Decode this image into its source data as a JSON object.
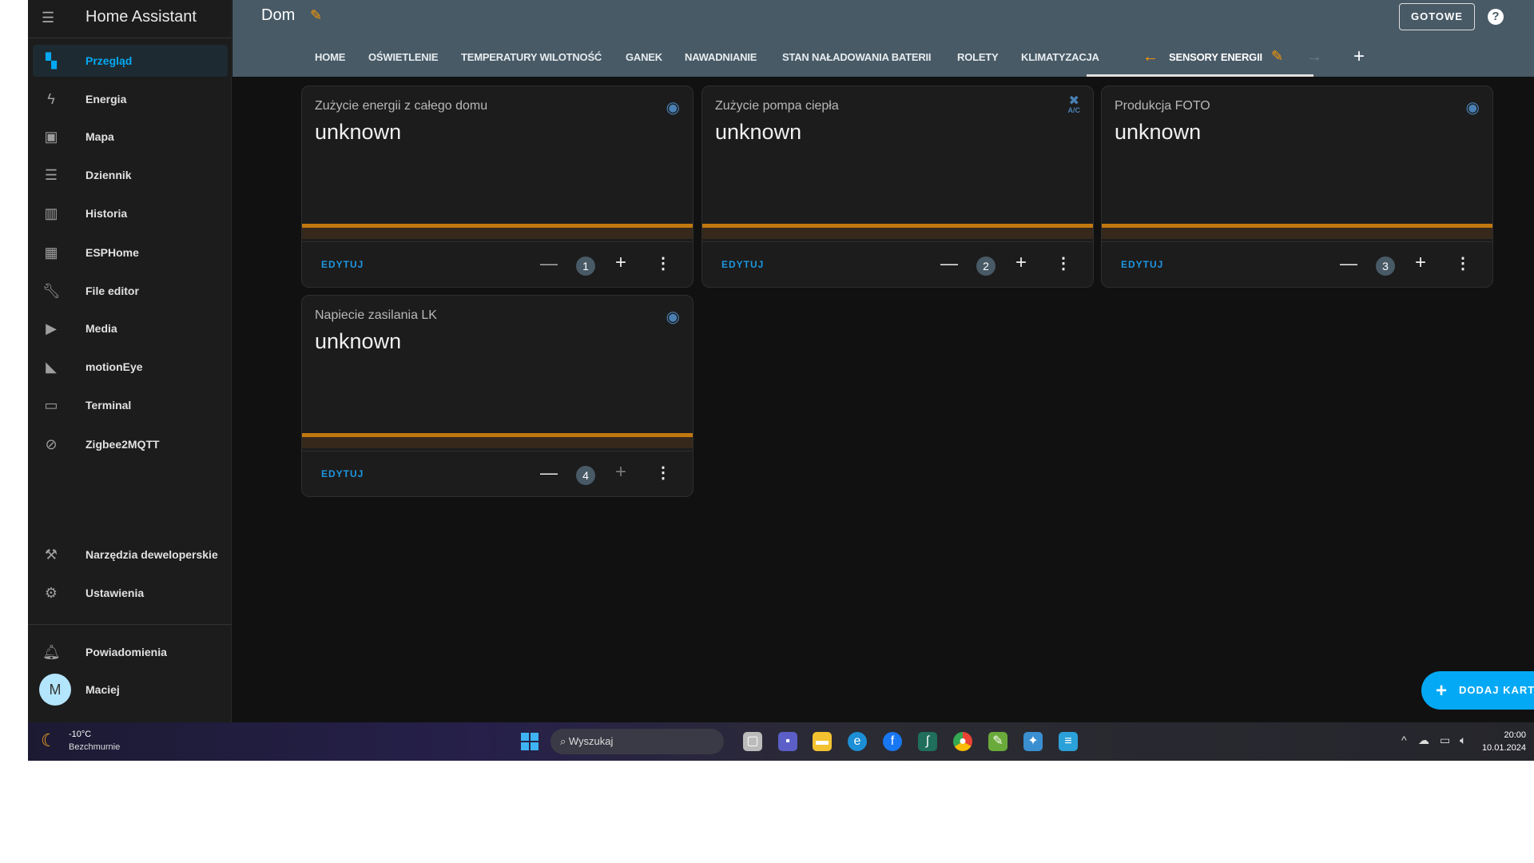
{
  "sidebar": {
    "title": "Home Assistant",
    "items": [
      {
        "label": "Przegląd",
        "icon": "dashboard-icon",
        "active": true
      },
      {
        "label": "Energia",
        "icon": "lightning-icon"
      },
      {
        "label": "Mapa",
        "icon": "map-person-icon"
      },
      {
        "label": "Dziennik",
        "icon": "list-icon"
      },
      {
        "label": "Historia",
        "icon": "chart-box-icon"
      },
      {
        "label": "ESPHome",
        "icon": "chip-icon"
      },
      {
        "label": "File editor",
        "icon": "wrench-icon"
      },
      {
        "label": "Media",
        "icon": "play-box-icon"
      },
      {
        "label": "motionEye",
        "icon": "cctv-icon"
      },
      {
        "label": "Terminal",
        "icon": "console-icon"
      },
      {
        "label": "Zigbee2MQTT",
        "icon": "zigbee-icon"
      }
    ],
    "bottom": [
      {
        "label": "Narzędzia deweloperskie",
        "icon": "hammer-icon"
      },
      {
        "label": "Ustawienia",
        "icon": "gear-icon"
      },
      {
        "label": "Powiadomienia",
        "icon": "bell-icon"
      }
    ],
    "user": {
      "initial": "M",
      "name": "Maciej"
    }
  },
  "header": {
    "title": "Dom",
    "done_label": "GOTOWE",
    "tabs": [
      "HOME",
      "OŚWIETLENIE",
      "TEMPERATURY WILOTNOŚĆ",
      "GANEK",
      "NAWADNIANIE",
      "STAN NAŁADOWANIA BATERII",
      "ROLETY",
      "KLIMATYZACJA",
      "SENSORY ENERGII"
    ],
    "active_tab": "SENSORY ENERGII"
  },
  "cards": [
    {
      "title": "Zużycie energii z całego domu",
      "value": "unknown",
      "icon": "eye-icon",
      "position": "1"
    },
    {
      "title": "Zużycie pompa ciepła",
      "value": "unknown",
      "icon": "air-conditioner-icon",
      "icon_text": "A/C",
      "position": "2"
    },
    {
      "title": "Produkcja FOTO",
      "value": "unknown",
      "icon": "eye-icon",
      "position": "3"
    },
    {
      "title": "Napiecie zasilania LK",
      "value": "unknown",
      "icon": "eye-icon",
      "position": "4"
    }
  ],
  "card_edit_label": "EDYTUJ",
  "fab_label": "DODAJ KARTĘ",
  "colors": {
    "accent": "#03a9f4",
    "header": "#485a66",
    "warning_bar": "#c0780f",
    "edit_pencil": "#ff9800"
  },
  "taskbar": {
    "temperature": "-10°C",
    "condition": "Bezchmurnie",
    "search_placeholder": "Wyszukaj",
    "time": "20:00",
    "date": "10.01.2024"
  }
}
